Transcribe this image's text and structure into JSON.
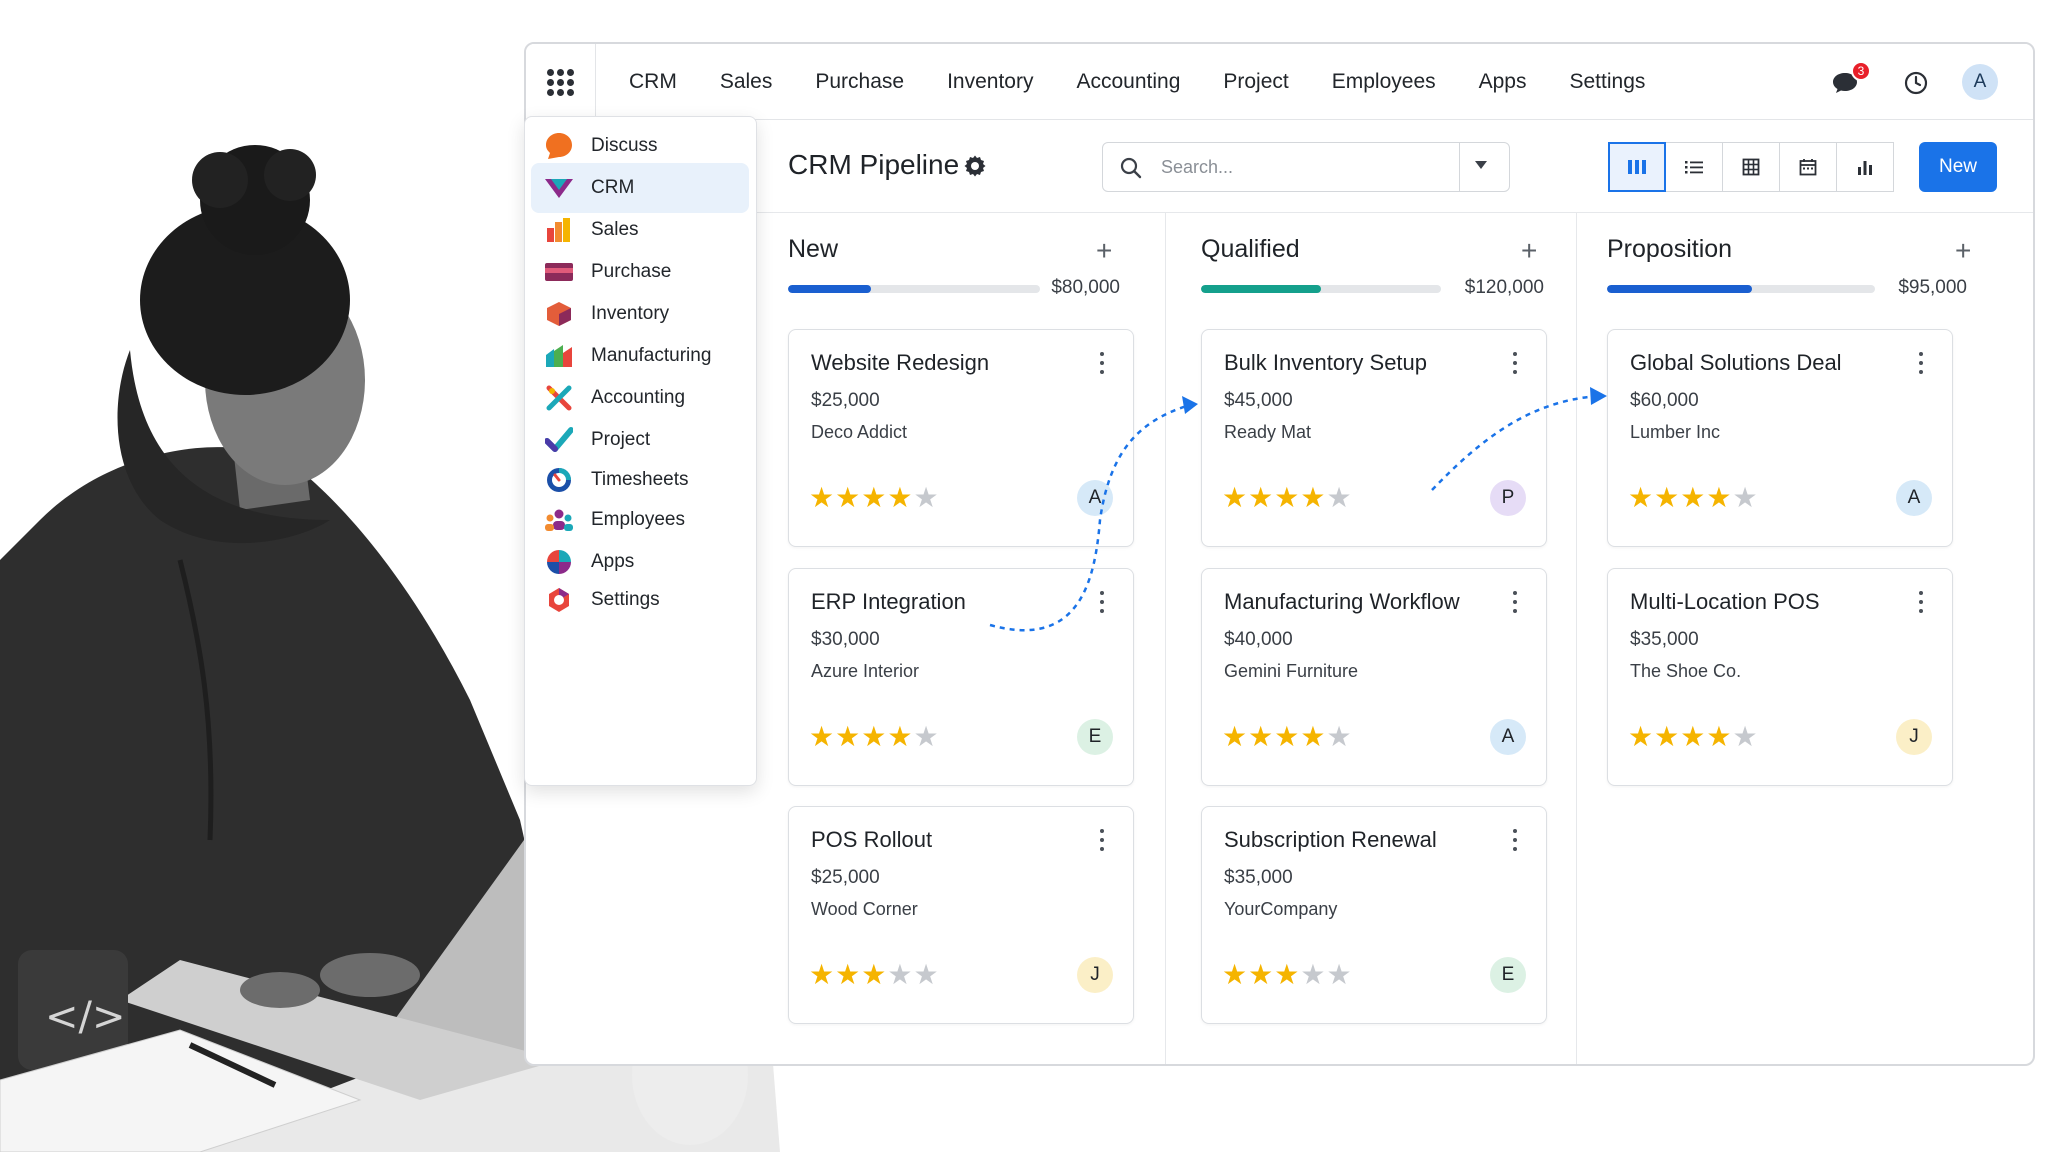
{
  "topnav": {
    "items": [
      "CRM",
      "Sales",
      "Purchase",
      "Inventory",
      "Accounting",
      "Project",
      "Employees",
      "Apps",
      "Settings"
    ],
    "notification_count": "3",
    "user_initial": "A"
  },
  "apps_menu": {
    "items": [
      {
        "label": "Discuss",
        "icon": "discuss-icon"
      },
      {
        "label": "CRM",
        "icon": "crm-icon",
        "active": true
      },
      {
        "label": "Sales",
        "icon": "sales-icon"
      },
      {
        "label": "Purchase",
        "icon": "purchase-icon"
      },
      {
        "label": "Inventory",
        "icon": "inventory-icon"
      },
      {
        "label": "Manufacturing",
        "icon": "manufacturing-icon"
      },
      {
        "label": "Accounting",
        "icon": "accounting-icon"
      },
      {
        "label": "Project",
        "icon": "project-icon"
      },
      {
        "label": "Timesheets",
        "icon": "timesheets-icon"
      },
      {
        "label": "Employees",
        "icon": "employees-icon"
      },
      {
        "label": "Apps",
        "icon": "apps-icon"
      },
      {
        "label": "Settings",
        "icon": "settings-icon"
      }
    ]
  },
  "control_panel": {
    "title": "CRM Pipeline",
    "search_placeholder": "Search...",
    "views": [
      "kanban-icon",
      "list-icon",
      "pivot-icon",
      "calendar-icon",
      "graph-icon"
    ],
    "active_view": "kanban-icon",
    "new_label": "New"
  },
  "colors": {
    "accent": "#1a73e8",
    "new_bar": "#1a5fd0",
    "qualified_bar": "#14a08c",
    "proposition_bar": "#1a5fd0",
    "star": "#f5b400"
  },
  "columns": [
    {
      "title": "New",
      "amount": "$80,000",
      "progress": 0.33,
      "cards": [
        {
          "title": "Website Redesign",
          "amount": "$25,000",
          "customer": "Deco Addict",
          "stars": 4,
          "avatar": "A",
          "avatar_color": "#d6e9f8"
        },
        {
          "title": "ERP Integration",
          "amount": "$30,000",
          "customer": "Azure Interior",
          "stars": 4,
          "avatar": "E",
          "avatar_color": "#dcf1e4"
        },
        {
          "title": "POS Rollout",
          "amount": "$25,000",
          "customer": "Wood Corner",
          "stars": 3,
          "avatar": "J",
          "avatar_color": "#fbefc7"
        }
      ]
    },
    {
      "title": "Qualified",
      "amount": "$120,000",
      "progress": 0.5,
      "cards": [
        {
          "title": "Bulk Inventory Setup",
          "amount": "$45,000",
          "customer": "Ready Mat",
          "stars": 4,
          "avatar": "P",
          "avatar_color": "#e6dcf6"
        },
        {
          "title": "Manufacturing Workflow",
          "amount": "$40,000",
          "customer": "Gemini Furniture",
          "stars": 4,
          "avatar": "A",
          "avatar_color": "#d6e9f8"
        },
        {
          "title": "Subscription Renewal",
          "amount": "$35,000",
          "customer": "YourCompany",
          "stars": 3,
          "avatar": "E",
          "avatar_color": "#dcf1e4"
        }
      ]
    },
    {
      "title": "Proposition",
      "amount": "$95,000",
      "progress": 0.54,
      "cards": [
        {
          "title": "Global Solutions Deal",
          "amount": "$60,000",
          "customer": "Lumber Inc",
          "stars": 4,
          "avatar": "A",
          "avatar_color": "#d6e9f8"
        },
        {
          "title": "Multi-Location POS",
          "amount": "$35,000",
          "customer": "The Shoe Co.",
          "stars": 4,
          "avatar": "J",
          "avatar_color": "#fbefc7"
        }
      ]
    }
  ]
}
